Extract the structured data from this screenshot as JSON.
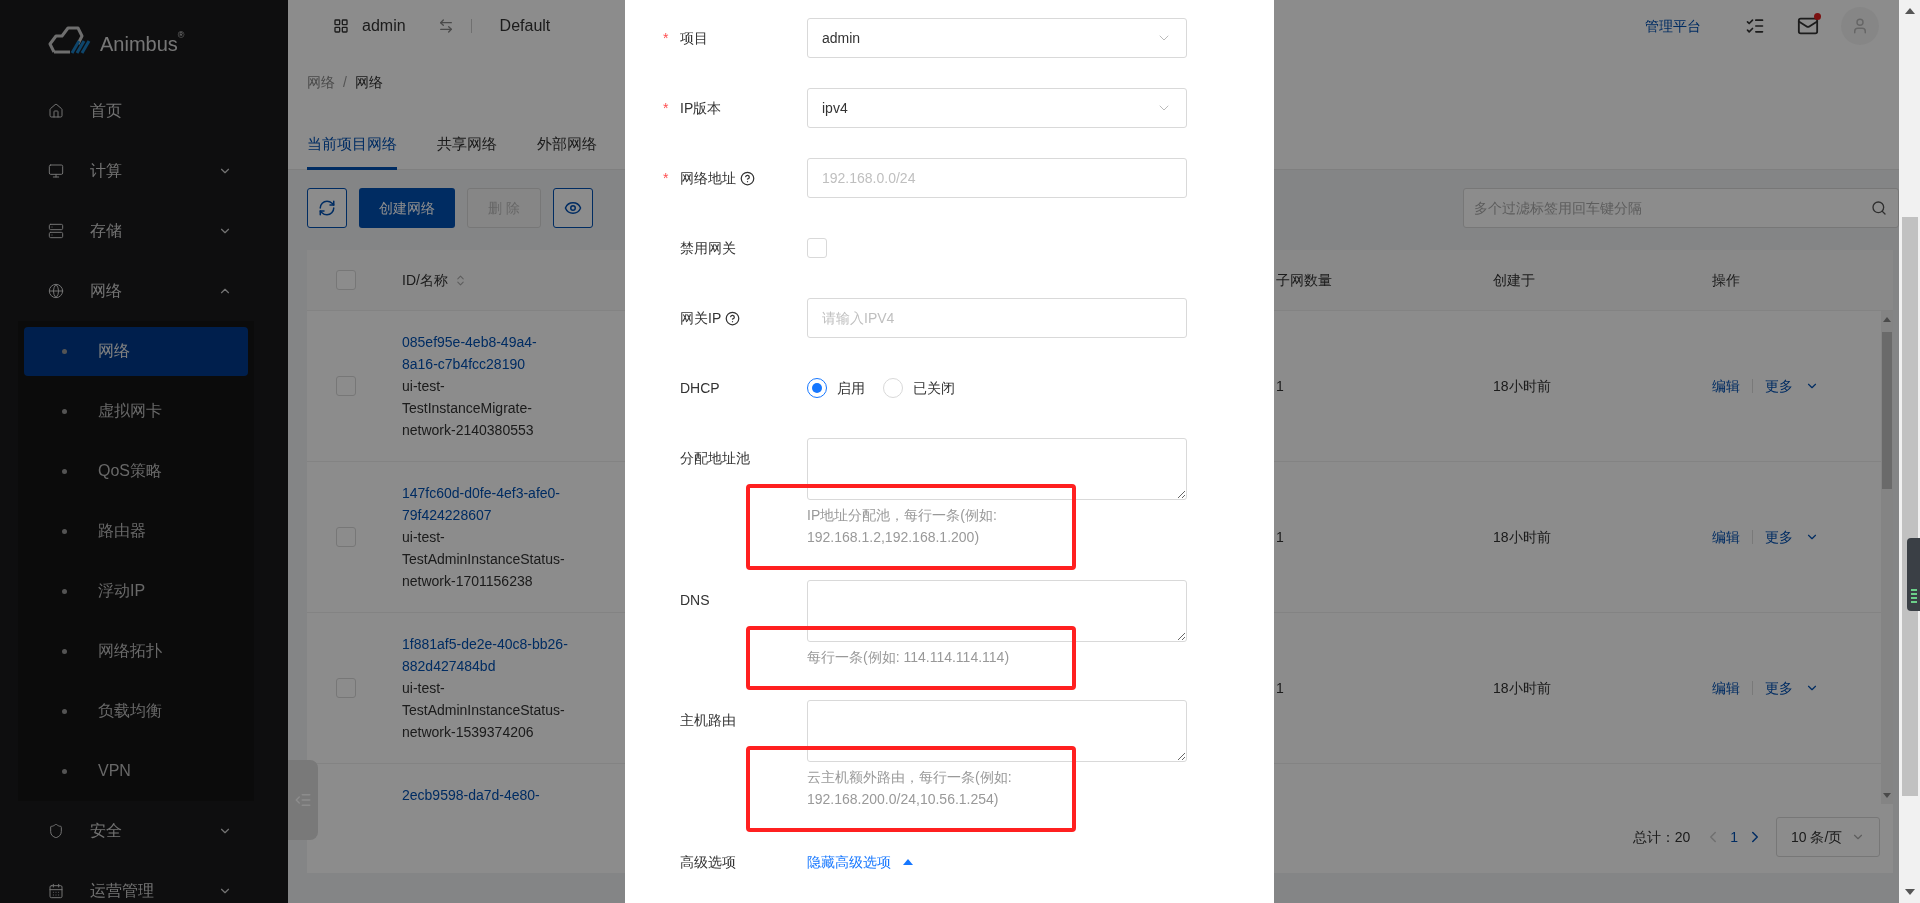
{
  "sidebar": {
    "brand": "Animbus",
    "brand_mark": "®",
    "items": [
      {
        "kind": "link",
        "label": "首页"
      },
      {
        "kind": "group",
        "label": "计算",
        "expanded": false
      },
      {
        "kind": "group",
        "label": "存储",
        "expanded": false
      },
      {
        "kind": "group",
        "label": "网络",
        "expanded": true,
        "children": [
          {
            "label": "网络",
            "selected": true
          },
          {
            "label": "虚拟网卡",
            "selected": false
          },
          {
            "label": "QoS策略",
            "selected": false
          },
          {
            "label": "路由器",
            "selected": false
          },
          {
            "label": "浮动IP",
            "selected": false
          },
          {
            "label": "网络拓扑",
            "selected": false
          },
          {
            "label": "负载均衡",
            "selected": false
          },
          {
            "label": "VPN",
            "selected": false
          }
        ]
      },
      {
        "kind": "group",
        "label": "安全",
        "expanded": false
      },
      {
        "kind": "group",
        "label": "运营管理",
        "expanded": false
      }
    ]
  },
  "topbar": {
    "project": "admin",
    "domain": "Default",
    "console_link": "管理平台",
    "mail_unread": true
  },
  "breadcrumb": {
    "separator": "/",
    "items": [
      "网络",
      "网络"
    ]
  },
  "tabs": [
    {
      "label": "当前项目网络",
      "selected": true
    },
    {
      "label": "共享网络",
      "selected": false
    },
    {
      "label": "外部网络",
      "selected": false
    }
  ],
  "toolbar": {
    "buttons": [
      {
        "kind": "refresh"
      },
      {
        "kind": "primary",
        "label": "创建网络",
        "disabled": false
      },
      {
        "kind": "default",
        "label": "删 除",
        "disabled": true
      },
      {
        "kind": "eye"
      }
    ],
    "search": {
      "placeholder": "多个过滤标签用回车键分隔"
    }
  },
  "table": {
    "select_all": false,
    "columns": [
      {
        "label": "ID/名称",
        "sortable": true
      },
      {
        "label": "子网数量",
        "sortable": false
      },
      {
        "label": "创建于",
        "sortable": false
      },
      {
        "label": "操作",
        "sortable": false
      }
    ],
    "rows": [
      {
        "checked": false,
        "id": "085ef95e-4eb8-49a4-8a16-c7b4fcc28190",
        "name": "ui-test-TestInstanceMigrate-network-2140380553",
        "subnets": "1",
        "created": "18小时前",
        "actions": [
          "编辑",
          "更多"
        ]
      },
      {
        "checked": false,
        "id": "147fc60d-d0fe-4ef3-afe0-79f424228607",
        "name": "ui-test-TestAdminInstanceStatus-network-1701156238",
        "subnets": "1",
        "created": "18小时前",
        "actions": [
          "编辑",
          "更多"
        ]
      },
      {
        "checked": false,
        "id": "1f881af5-de2e-40c8-bb26-882d427484bd",
        "name": "ui-test-TestAdminInstanceStatus-network-1539374206",
        "subnets": "1",
        "created": "18小时前",
        "actions": [
          "编辑",
          "更多"
        ]
      },
      {
        "id": "2ecb9598-da7d-4e80-"
      }
    ]
  },
  "pagination": {
    "total": "总计：20",
    "pages": [
      {
        "label": "1",
        "selected": true
      }
    ],
    "page_size": "10 条/页"
  },
  "form": {
    "required_symbol": "*",
    "items": [
      {
        "kind": "select",
        "label": "项目",
        "required": true,
        "help_icon": false,
        "value": "admin"
      },
      {
        "kind": "select",
        "label": "IP版本",
        "required": true,
        "help_icon": false,
        "value": "ipv4"
      },
      {
        "kind": "input",
        "label": "网络地址",
        "required": true,
        "help_icon": true,
        "placeholder": "192.168.0.0/24"
      },
      {
        "kind": "checkbox",
        "label": "禁用网关",
        "required": false,
        "help_icon": false,
        "checked": false
      },
      {
        "kind": "input",
        "label": "网关IP",
        "required": false,
        "help_icon": true,
        "placeholder": "请输入IPV4"
      },
      {
        "kind": "radio",
        "label": "DHCP",
        "required": false,
        "help_icon": false,
        "options": [
          {
            "label": "启用",
            "selected": true
          },
          {
            "label": "已关闭",
            "selected": false
          }
        ]
      },
      {
        "kind": "textarea",
        "label": "分配地址池",
        "required": false,
        "help_icon": false,
        "help": "IP地址分配池，每行一条(例如: 192.168.1.2,192.168.1.200)",
        "highlighted": true
      },
      {
        "kind": "textarea",
        "label": "DNS",
        "required": false,
        "help_icon": false,
        "help": "每行一条(例如: 114.114.114.114)",
        "highlighted": true
      },
      {
        "kind": "textarea",
        "label": "主机路由",
        "required": false,
        "help_icon": false,
        "help": "云主机额外路由，每行一条(例如: 192.168.200.0/24,10.56.1.254)",
        "highlighted": true
      },
      {
        "kind": "toggle",
        "label": "高级选项",
        "required": false,
        "help_icon": false,
        "link": "隐藏高级选项",
        "expanded": true
      }
    ]
  }
}
